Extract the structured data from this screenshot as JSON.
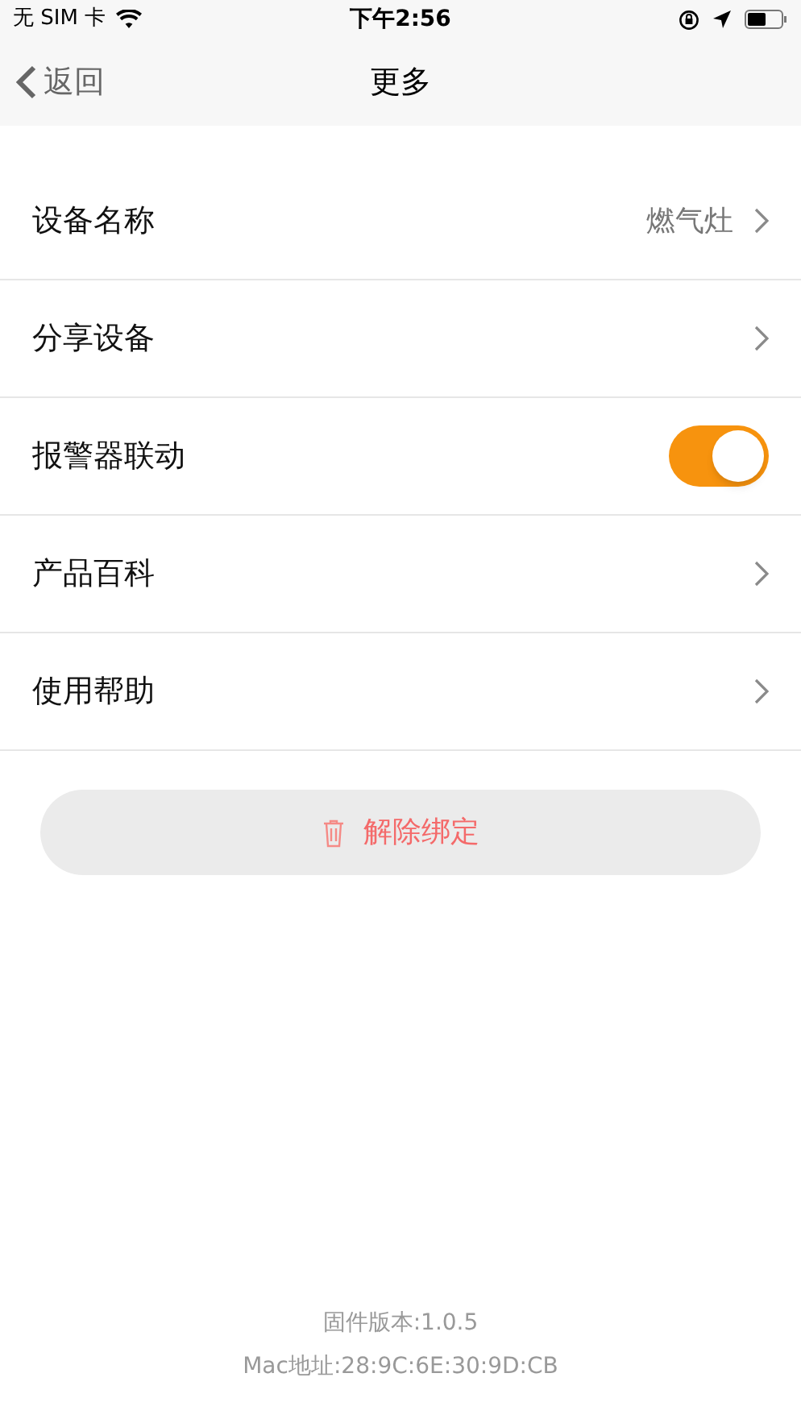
{
  "status_bar": {
    "carrier": "无 SIM 卡",
    "time": "下午2:56"
  },
  "nav": {
    "back": "返回",
    "title": "更多"
  },
  "rows": [
    {
      "kind": "link",
      "label": "设备名称",
      "value": "燃气灶"
    },
    {
      "kind": "link",
      "label": "分享设备"
    },
    {
      "kind": "toggle",
      "label": "报警器联动",
      "on": true
    },
    {
      "kind": "link",
      "label": "产品百科"
    },
    {
      "kind": "link",
      "label": "使用帮助"
    }
  ],
  "unbind_button": "解除绑定",
  "footer": {
    "firmware": "固件版本:1.0.5",
    "mac": "Mac地址:28:9C:6E:30:9D:CB"
  }
}
